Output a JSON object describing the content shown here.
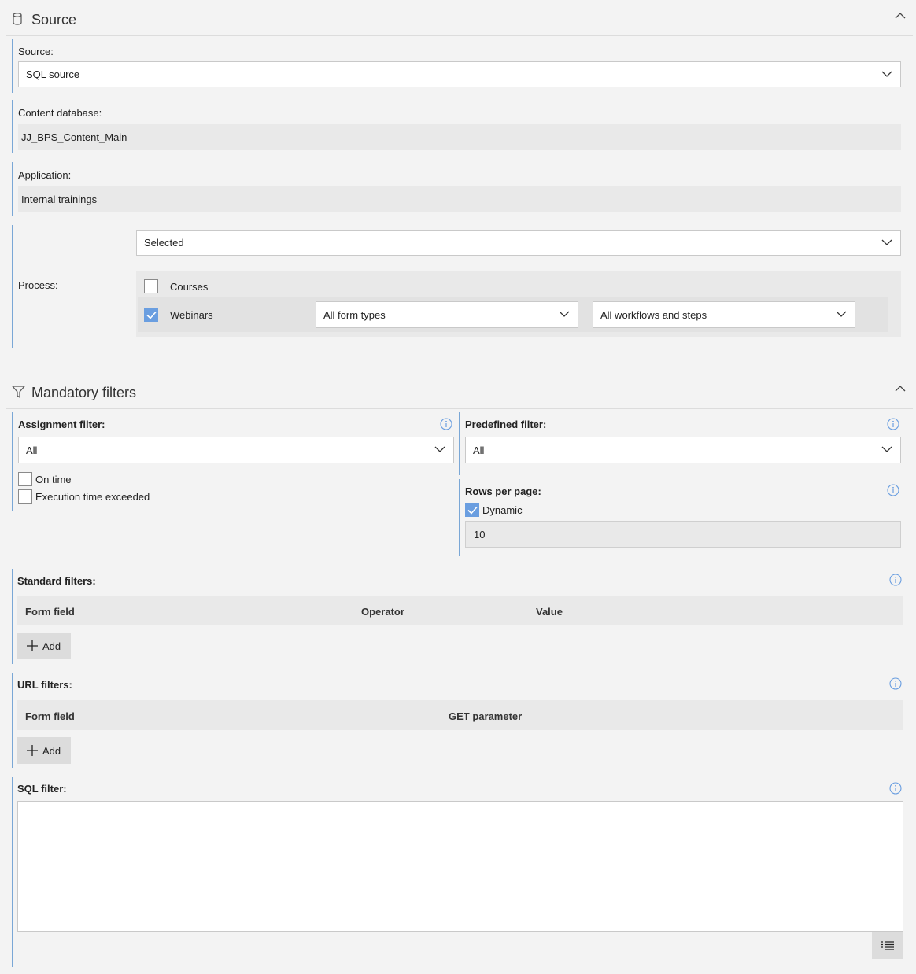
{
  "source_section": {
    "title": "Source",
    "source_label": "Source:",
    "source_value": "SQL source",
    "content_db_label": "Content database:",
    "content_db_value": "JJ_BPS_Content_Main",
    "application_label": "Application:",
    "application_value": "Internal trainings",
    "process_label": "Process:",
    "process_mode": "Selected",
    "processes": [
      {
        "name": "Courses",
        "checked": false
      },
      {
        "name": "Webinars",
        "checked": true,
        "form_types": "All form types",
        "workflows": "All workflows and steps"
      }
    ]
  },
  "filters_section": {
    "title": "Mandatory filters",
    "assignment_label": "Assignment filter:",
    "assignment_value": "All",
    "on_time_label": "On time",
    "exceeded_label": "Execution time exceeded",
    "predefined_label": "Predefined filter:",
    "predefined_value": "All",
    "rows_label": "Rows per page:",
    "dynamic_label": "Dynamic",
    "rows_value": "10",
    "standard_label": "Standard filters:",
    "standard_cols": [
      "Form field",
      "Operator",
      "Value"
    ],
    "add_label": "Add",
    "url_label": "URL filters:",
    "url_cols": [
      "Form field",
      "GET parameter"
    ],
    "sql_label": "SQL filter:"
  }
}
